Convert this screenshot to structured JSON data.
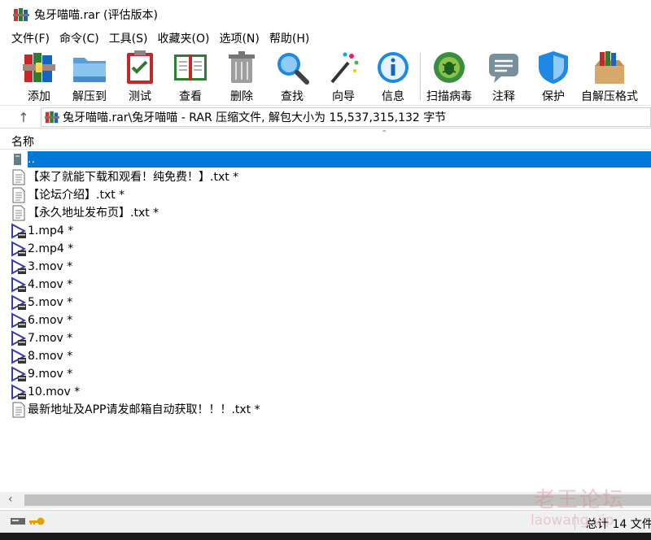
{
  "window": {
    "title": "兔牙喵喵.rar (评估版本)",
    "app_icon": "winrar-books-icon"
  },
  "menu": [
    {
      "label": "文件(F)"
    },
    {
      "label": "命令(C)"
    },
    {
      "label": "工具(S)"
    },
    {
      "label": "收藏夹(O)"
    },
    {
      "label": "选项(N)"
    },
    {
      "label": "帮助(H)"
    }
  ],
  "toolbar": [
    {
      "label": "添加",
      "icon": "add-archive-icon"
    },
    {
      "label": "解压到",
      "icon": "extract-folder-icon"
    },
    {
      "label": "测试",
      "icon": "test-clipboard-icon"
    },
    {
      "label": "查看",
      "icon": "view-book-icon"
    },
    {
      "label": "删除",
      "icon": "trash-icon"
    },
    {
      "label": "查找",
      "icon": "magnifier-icon"
    },
    {
      "label": "向导",
      "icon": "wizard-wand-icon"
    },
    {
      "label": "信息",
      "icon": "info-icon"
    },
    {
      "label": "扫描病毒",
      "icon": "virus-scan-icon"
    },
    {
      "label": "注释",
      "icon": "comment-icon"
    },
    {
      "label": "保护",
      "icon": "shield-icon"
    },
    {
      "label": "自解压格式",
      "icon": "sfx-box-icon"
    }
  ],
  "address": {
    "path": "兔牙喵喵.rar\\兔牙喵喵 - RAR 压缩文件, 解包大小为 15,537,315,132 字节"
  },
  "list": {
    "column_name": "名称",
    "rows": [
      {
        "name": "..",
        "icon": "parent-folder-icon",
        "selected": true
      },
      {
        "name": "【来了就能下载和观看！纯免费！】.txt *",
        "icon": "text-file-icon"
      },
      {
        "name": "【论坛介绍】.txt *",
        "icon": "text-file-icon"
      },
      {
        "name": "【永久地址发布页】.txt *",
        "icon": "text-file-icon"
      },
      {
        "name": "1.mp4 *",
        "icon": "video-file-icon"
      },
      {
        "name": "2.mp4 *",
        "icon": "video-file-icon"
      },
      {
        "name": "3.mov *",
        "icon": "video-file-icon"
      },
      {
        "name": "4.mov *",
        "icon": "video-file-icon"
      },
      {
        "name": "5.mov *",
        "icon": "video-file-icon"
      },
      {
        "name": "6.mov *",
        "icon": "video-file-icon"
      },
      {
        "name": "7.mov *",
        "icon": "video-file-icon"
      },
      {
        "name": "8.mov *",
        "icon": "video-file-icon"
      },
      {
        "name": "9.mov *",
        "icon": "video-file-icon"
      },
      {
        "name": "10.mov *",
        "icon": "video-file-icon"
      },
      {
        "name": "最新地址及APP请发邮箱自动获取！！！.txt *",
        "icon": "text-file-icon"
      }
    ]
  },
  "status": {
    "text": "总计 14 文件",
    "icons": [
      "drive-icon",
      "key-icon"
    ]
  },
  "watermark": {
    "cn": "老王论坛",
    "en": "laowang.vip"
  },
  "colors": {
    "selection": "#0078d7",
    "video_icon": "#3a3aa8"
  }
}
